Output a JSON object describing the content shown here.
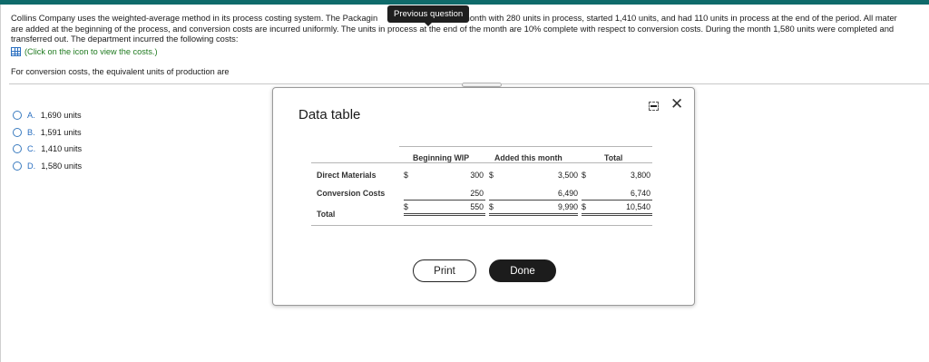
{
  "question": {
    "line1a": "Collins Company uses the weighted-average method in its process costing system. The Packagin",
    "line1b": "e month with 280 units in process, started 1,410 units, and had 110 units in process at the end of the period. All mater",
    "line2": "are added at the beginning of the process, and conversion costs are incurred uniformly. The units in process at the end of the month are 10% complete with respect to conversion costs. During the month 1,580 units were completed and",
    "line3": "transferred out. The department incurred the following costs:",
    "link_text": "(Click on the icon to view the costs.)",
    "prompt": "For conversion costs, the equivalent units of production are"
  },
  "tooltip": {
    "text": "Previous question"
  },
  "options": [
    {
      "letter": "A.",
      "text": "1,690 units"
    },
    {
      "letter": "B.",
      "text": "1,591 units"
    },
    {
      "letter": "C.",
      "text": "1,410 units"
    },
    {
      "letter": "D.",
      "text": "1,580 units"
    }
  ],
  "modal": {
    "title": "Data table",
    "print_label": "Print",
    "done_label": "Done",
    "table": {
      "headers": [
        "Beginning WIP",
        "Added this month",
        "Total"
      ],
      "currency": "$",
      "rows": [
        {
          "label": "Direct Materials",
          "values": [
            "300",
            "3,500",
            "3,800"
          ]
        },
        {
          "label": "Conversion Costs",
          "values": [
            "250",
            "6,490",
            "6,740"
          ]
        },
        {
          "label": "Total",
          "values": [
            "550",
            "9,990",
            "10,540"
          ]
        }
      ]
    }
  },
  "colors": {
    "accent_bar": "#0f6b6b",
    "link": "#1f7a1f",
    "option_letter": "#2a6fc0"
  },
  "icons": [
    "table-icon",
    "minimize-icon",
    "close-icon",
    "radio-icon"
  ]
}
